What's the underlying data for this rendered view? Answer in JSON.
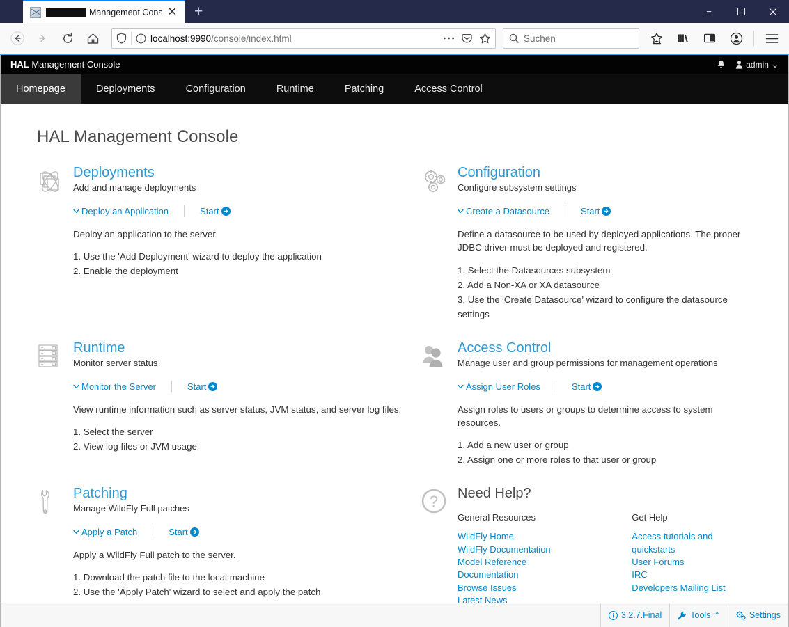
{
  "browser": {
    "tab": {
      "title_suffix": "Management Cons",
      "redacted": true,
      "close_label": "✕"
    },
    "new_tab_label": "+",
    "window_controls": {
      "minimize": "−",
      "maximize": "□",
      "close": "✕"
    },
    "nav": {
      "back": "back-arrow",
      "forward": "forward-arrow",
      "reload": "reload",
      "home": "home"
    },
    "url": {
      "host": "localhost:9990",
      "path": "/console/index.html"
    },
    "search": {
      "placeholder": "Suchen"
    },
    "toolbar_icons": [
      "shield-icon",
      "info-icon",
      "page-actions-icon",
      "pocket-icon",
      "bookmark-star-icon",
      "save-to-pocket-icon",
      "library-icon",
      "sidebar-icon",
      "account-icon",
      "menu-icon"
    ]
  },
  "header": {
    "brand_bold": "HAL",
    "brand_rest": " Management Console",
    "notifications_icon": "bell-icon",
    "user": "admin",
    "user_caret": "⌄"
  },
  "nav_tabs": [
    {
      "label": "Homepage",
      "active": true
    },
    {
      "label": "Deployments",
      "active": false
    },
    {
      "label": "Configuration",
      "active": false
    },
    {
      "label": "Runtime",
      "active": false
    },
    {
      "label": "Patching",
      "active": false
    },
    {
      "label": "Access Control",
      "active": false
    }
  ],
  "page": {
    "title": "HAL Management Console"
  },
  "cards": {
    "deployments": {
      "title": "Deployments",
      "subtitle": "Add and manage deployments",
      "action_link": "Deploy an Application",
      "start_label": "Start",
      "lead": "Deploy an application to the server",
      "steps": [
        "1. Use the 'Add Deployment' wizard to deploy the application",
        "2. Enable the deployment"
      ]
    },
    "configuration": {
      "title": "Configuration",
      "subtitle": "Configure subsystem settings",
      "action_link": "Create a Datasource",
      "start_label": "Start",
      "lead": "Define a datasource to be used by deployed applications. The proper JDBC driver must be deployed and registered.",
      "steps": [
        "1. Select the Datasources subsystem",
        "2. Add a Non-XA or XA datasource",
        "3. Use the 'Create Datasource' wizard to configure the datasource settings"
      ]
    },
    "runtime": {
      "title": "Runtime",
      "subtitle": "Monitor server status",
      "action_link": "Monitor the Server",
      "start_label": "Start",
      "lead": "View runtime information such as server status, JVM status, and server log files.",
      "steps": [
        "1. Select the server",
        "2. View log files or JVM usage"
      ]
    },
    "access_control": {
      "title": "Access Control",
      "subtitle": "Manage user and group permissions for management operations",
      "action_link": "Assign User Roles",
      "start_label": "Start",
      "lead": "Assign roles to users or groups to determine access to system resources.",
      "steps": [
        "1. Add a new user or group",
        "2. Assign one or more roles to that user or group"
      ]
    },
    "patching": {
      "title": "Patching",
      "subtitle": "Manage WildFly Full patches",
      "action_link": "Apply a Patch",
      "start_label": "Start",
      "lead": "Apply a WildFly Full patch to the server.",
      "steps": [
        "1. Download the patch file to the local machine",
        "2. Use the 'Apply Patch' wizard to select and apply the patch"
      ]
    },
    "help": {
      "title": "Need Help?",
      "general_heading": "General Resources",
      "general_links": [
        "WildFly Home",
        "WildFly Documentation",
        "Model Reference Documentation",
        "Browse Issues",
        "Latest News"
      ],
      "gethelp_heading": "Get Help",
      "gethelp_links": [
        "Access tutorials and quickstarts",
        "User Forums",
        "IRC",
        "Developers Mailing List"
      ]
    }
  },
  "footer": {
    "version": "3.2.7.Final",
    "tools": "Tools",
    "tools_caret": "⌃",
    "settings": "Settings"
  },
  "colors": {
    "accent_link": "#0088cc",
    "card_title": "#2e9ad4",
    "header_bg": "#030303",
    "nav_bg": "#0d0d0d",
    "active_tab_bg": "#3a3a3a",
    "browser_title_bg": "#25294a",
    "tab_accent": "#0a84ff",
    "icon_gray": "#b3b3b3"
  }
}
